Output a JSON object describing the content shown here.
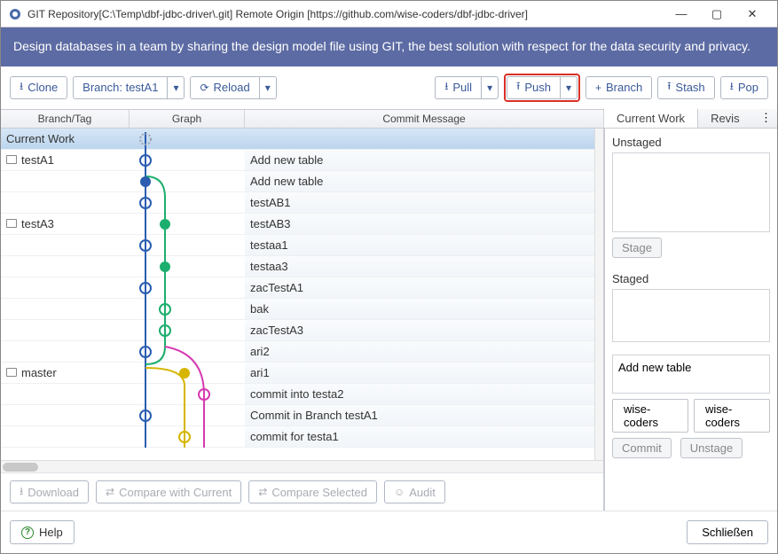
{
  "window": {
    "title": "GIT Repository[C:\\Temp\\dbf-jdbc-driver\\.git] Remote Origin [https://github.com/wise-coders/dbf-jdbc-driver]"
  },
  "banner": "Design databases in a team by sharing the design model file using GIT, the best solution with respect for the data security and privacy.",
  "toolbar": {
    "clone": "Clone",
    "branch_selector": "Branch: testA1",
    "reload": "Reload",
    "pull": "Pull",
    "push": "Push",
    "branch": "Branch",
    "stash": "Stash",
    "pop": "Pop"
  },
  "headers": {
    "branch": "Branch/Tag",
    "graph": "Graph",
    "msg": "Commit Message"
  },
  "rows": [
    {
      "branch": "Current Work",
      "msg": "",
      "icon": false,
      "selected": true
    },
    {
      "branch": "testA1",
      "msg": "Add new table",
      "icon": true
    },
    {
      "branch": "",
      "msg": "Add new table"
    },
    {
      "branch": "",
      "msg": "testAB1"
    },
    {
      "branch": "testA3",
      "msg": "testAB3",
      "icon": true
    },
    {
      "branch": "",
      "msg": "testaa1"
    },
    {
      "branch": "",
      "msg": "testaa3"
    },
    {
      "branch": "",
      "msg": "zacTestA1"
    },
    {
      "branch": "",
      "msg": "bak"
    },
    {
      "branch": "",
      "msg": "zacTestA3"
    },
    {
      "branch": "",
      "msg": "ari2"
    },
    {
      "branch": "master",
      "msg": "ari1",
      "icon": true
    },
    {
      "branch": "",
      "msg": "commit into testa2"
    },
    {
      "branch": "",
      "msg": "Commit in Branch testA1"
    },
    {
      "branch": "",
      "msg": "commit for testa1"
    }
  ],
  "secondary": {
    "download": "Download",
    "compare_current": "Compare with Current",
    "compare_selected": "Compare Selected",
    "audit": "Audit"
  },
  "right": {
    "tab1": "Current Work",
    "tab2": "Revis",
    "unstaged": "Unstaged",
    "stage_btn": "Stage",
    "staged": "Staged",
    "commit_msg": "Add new table",
    "author1": "wise-coders",
    "author2": "wise-coders",
    "commit_btn": "Commit",
    "unstage_btn": "Unstage"
  },
  "footer": {
    "help": "Help",
    "close": "Schließen"
  }
}
